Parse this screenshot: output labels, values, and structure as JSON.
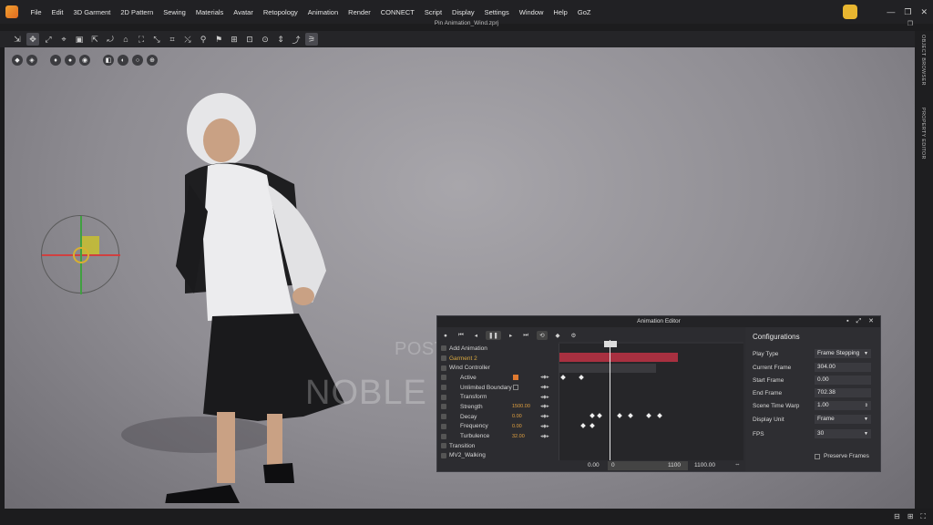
{
  "menu": [
    "File",
    "Edit",
    "3D Garment",
    "2D Pattern",
    "Sewing",
    "Materials",
    "Avatar",
    "Retopology",
    "Animation",
    "Render",
    "CONNECT",
    "Script",
    "Display",
    "Settings",
    "Window",
    "Help",
    "GoZ"
  ],
  "window_title": "Pin Animation_Wind.zprj",
  "side_panels": [
    "OBJECT BROWSER",
    "PROPERTY EDITOR"
  ],
  "watermark": {
    "small": "POSTED ON JIJI",
    "big": "NOBLE SOFTWARES"
  },
  "anim_editor": {
    "title": "Animation Editor",
    "add_animation": "Add Animation",
    "tree": [
      {
        "label": "Garment 2",
        "gold": true
      },
      {
        "label": "Wind Controller"
      },
      {
        "label": "Active",
        "checkbox": true
      },
      {
        "label": "Unlimited Boundary",
        "checkbox": false
      },
      {
        "label": "Transform"
      },
      {
        "label": "Strength",
        "value": "1500.00"
      },
      {
        "label": "Decay",
        "value": "0.00"
      },
      {
        "label": "Frequency",
        "value": "0.00"
      },
      {
        "label": "Turbulence",
        "value": "32.00"
      },
      {
        "label": "Transition"
      },
      {
        "label": "MV2_Walking"
      }
    ],
    "footer": {
      "start": "0.00",
      "range_start": "0",
      "range_end": "1100",
      "end": "1100.00"
    }
  },
  "config": {
    "title": "Configurations",
    "play_type": {
      "label": "Play Type",
      "value": "Frame Stepping"
    },
    "current_frame": {
      "label": "Current Frame",
      "value": "304.00"
    },
    "start_frame": {
      "label": "Start Frame",
      "value": "0.00"
    },
    "end_frame": {
      "label": "End Frame",
      "value": "702.38"
    },
    "scene_time_warp": {
      "label": "Scene Time Warp",
      "value": "1.00"
    },
    "display_unit": {
      "label": "Display Unit",
      "value": "Frame"
    },
    "fps": {
      "label": "FPS",
      "value": "30"
    },
    "preserve_frames": "Preserve Frames"
  }
}
